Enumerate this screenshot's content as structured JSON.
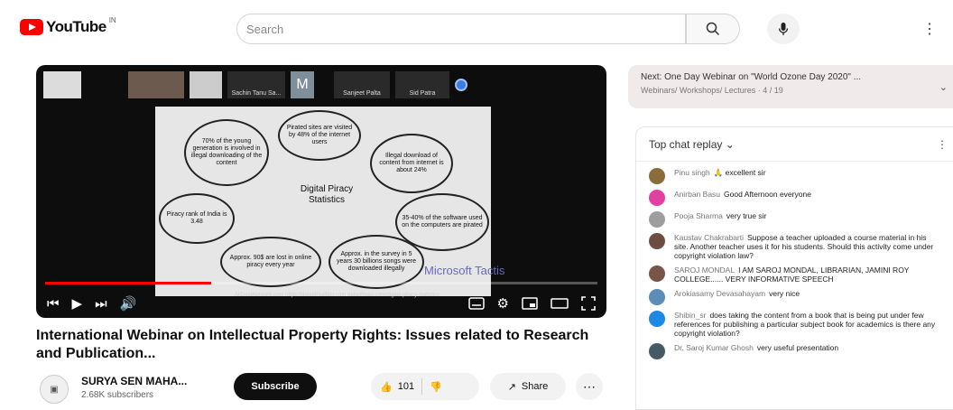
{
  "app": {
    "logo_text": "YouTube",
    "logo_country": "IN"
  },
  "search": {
    "placeholder": "Search"
  },
  "player": {
    "participants": [
      "",
      "",
      "",
      "Sachin Tanu Sa...",
      "M",
      "Sanjeet Palta",
      "Sid Patra",
      ""
    ],
    "slide": {
      "center": "Digital Piracy Statistics",
      "bubbles": [
        "Pirated sites are visited by 48% of the internet users",
        "Illegal download of content from internet is about 24%",
        "35-40% of the software used on the computers are pirated",
        "Approx. in the survey in 5 years 30 billions songs were downloaded illegally",
        "Approx. 90$ are lost in online piracy every year",
        "Piracy rank of India is 3.48",
        "70% of the young generation is involved in illegal downloading of the content"
      ],
      "watermark": "Microsoft Tactis",
      "url": "AllDataNetwork.com  https://dataofrealfact.com  dataofroad.com/digital-piracy-statistics"
    },
    "progress": 0.3
  },
  "video": {
    "title": "International Webinar on Intellectual Property Rights: Issues related to Research and Publication...",
    "channel_name": "SURYA SEN MAHA...",
    "subscribers": "2.68K subscribers",
    "subscribe_label": "Subscribe",
    "likes": "101",
    "share_label": "Share"
  },
  "next": {
    "title": "Next: One Day Webinar on \"World Ozone Day 2020\" ...",
    "subtitle": "Webinars/ Workshops/ Lectures · 4 / 19"
  },
  "chat": {
    "header": "Top chat replay",
    "messages": [
      {
        "author": "Pinu singh",
        "text": "🙏 excellent sir",
        "color": "#8a6d3b"
      },
      {
        "author": "Anirban Basu",
        "text": "Good Afternoon everyone",
        "color": "#e040a0"
      },
      {
        "author": "Pooja Sharma",
        "text": "very true sir",
        "color": "#9e9e9e"
      },
      {
        "author": "Kaustav Chakrabarti",
        "text": "Suppose a teacher uploaded a course material in his site. Another teacher uses it for his students. Should this activity come under copyright violation law?",
        "color": "#6d4c41"
      },
      {
        "author": "SAROJ MONDAL",
        "text": "I AM SAROJ MONDAL, LIBRARIAN, JAMINI ROY COLLEGE...... VERY INFORMATIVE SPEECH",
        "color": "#795548"
      },
      {
        "author": "Arokiasamy Devasahayam",
        "text": "very nice",
        "color": "#5c8db8"
      },
      {
        "author": "Shibin_sr",
        "text": "does taking the content from a book that is being put under few references for publishing a particular subject book for academics is there any copyright violation?",
        "color": "#1e88e5"
      },
      {
        "author": "Dr. Saroj Kumar Ghosh",
        "text": "very useful presentation",
        "color": "#455a64"
      }
    ]
  },
  "colors": {
    "brand_red": "#ff0000",
    "subscribe_bg": "#0f0f0f"
  }
}
